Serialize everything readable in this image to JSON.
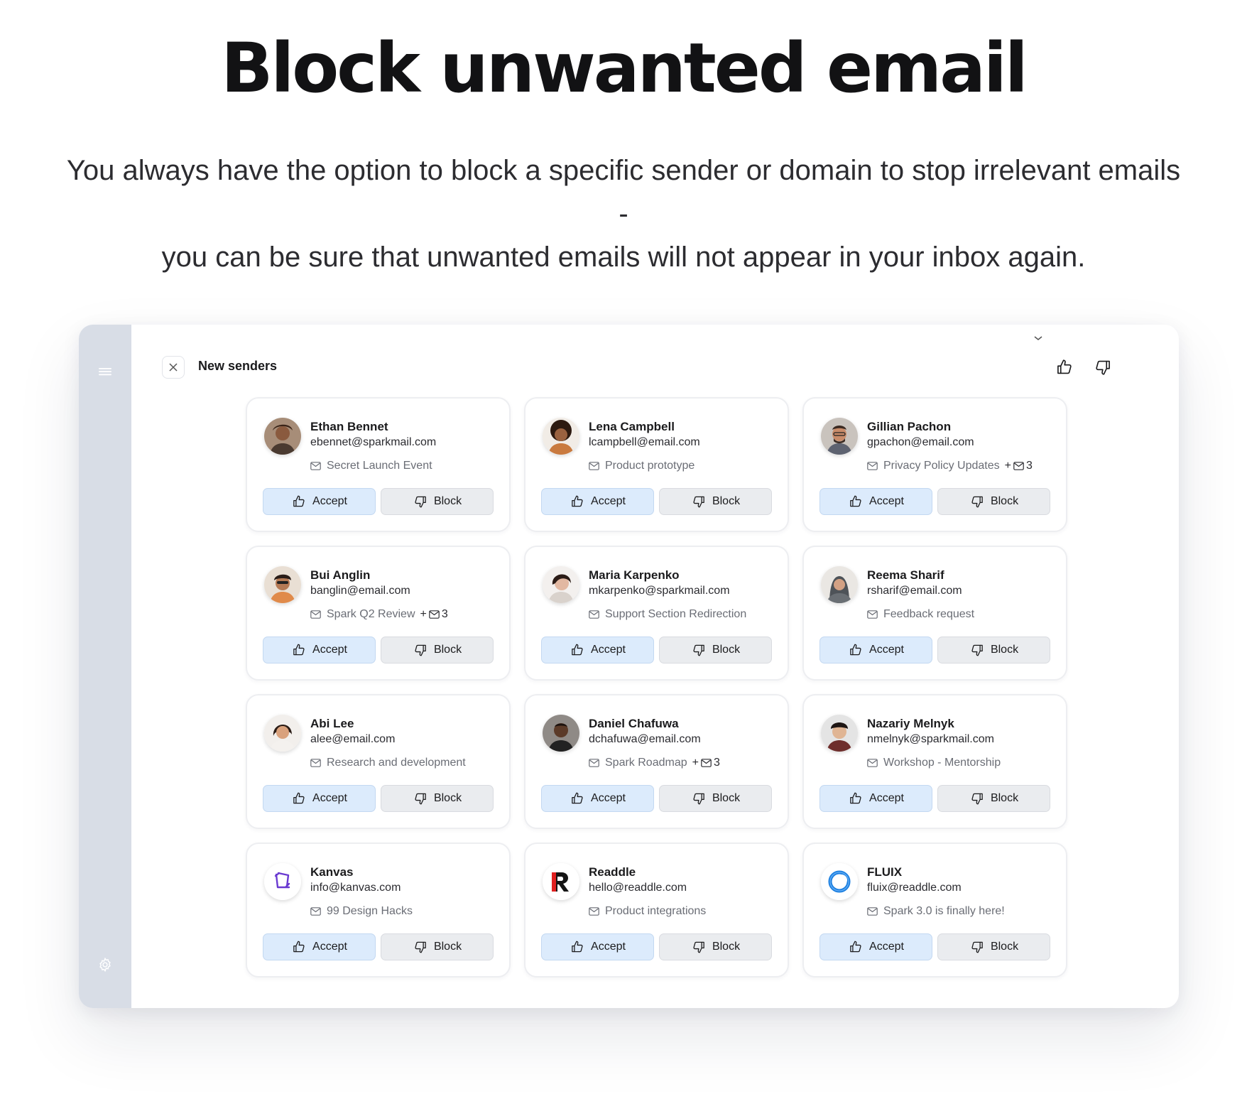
{
  "hero": {
    "title": "Block unwanted email",
    "subtitle_line1": "You always have the option to block a specific sender or domain to stop irrelevant emails -",
    "subtitle_line2": "you can be sure that unwanted emails will not appear in your inbox again."
  },
  "panel": {
    "title": "New senders"
  },
  "buttons": {
    "accept_label": "Accept",
    "block_label": "Block"
  },
  "colors": {
    "accept_bg": "#dcebfc",
    "block_bg": "#eaecef",
    "sidebar_bg": "#d8dde6"
  },
  "senders": [
    {
      "name": "Ethan Bennet",
      "email": "ebennet@sparkmail.com",
      "subject": "Secret Launch Event",
      "extra": ""
    },
    {
      "name": "Lena Campbell",
      "email": "lcampbell@email.com",
      "subject": "Product prototype",
      "extra": ""
    },
    {
      "name": "Gillian Pachon",
      "email": "gpachon@email.com",
      "subject": "Privacy Policy Updates",
      "extra": "3"
    },
    {
      "name": "Bui Anglin",
      "email": "banglin@email.com",
      "subject": "Spark Q2 Review",
      "extra": "3"
    },
    {
      "name": "Maria Karpenko",
      "email": "mkarpenko@sparkmail.com",
      "subject": "Support Section Redirection",
      "extra": ""
    },
    {
      "name": "Reema Sharif",
      "email": "rsharif@email.com",
      "subject": "Feedback request",
      "extra": ""
    },
    {
      "name": "Abi Lee",
      "email": "alee@email.com",
      "subject": "Research and development",
      "extra": ""
    },
    {
      "name": "Daniel Chafuwa",
      "email": "dchafuwa@email.com",
      "subject": "Spark Roadmap",
      "extra": "3"
    },
    {
      "name": "Nazariy Melnyk",
      "email": "nmelnyk@sparkmail.com",
      "subject": "Workshop - Mentorship",
      "extra": ""
    },
    {
      "name": "Kanvas",
      "email": "info@kanvas.com",
      "subject": "99 Design Hacks",
      "extra": ""
    },
    {
      "name": "Readdle",
      "email": "hello@readdle.com",
      "subject": "Product integrations",
      "extra": ""
    },
    {
      "name": "FLUIX",
      "email": "fluix@readdle.com",
      "subject": "Spark 3.0 is finally here!",
      "extra": ""
    }
  ]
}
